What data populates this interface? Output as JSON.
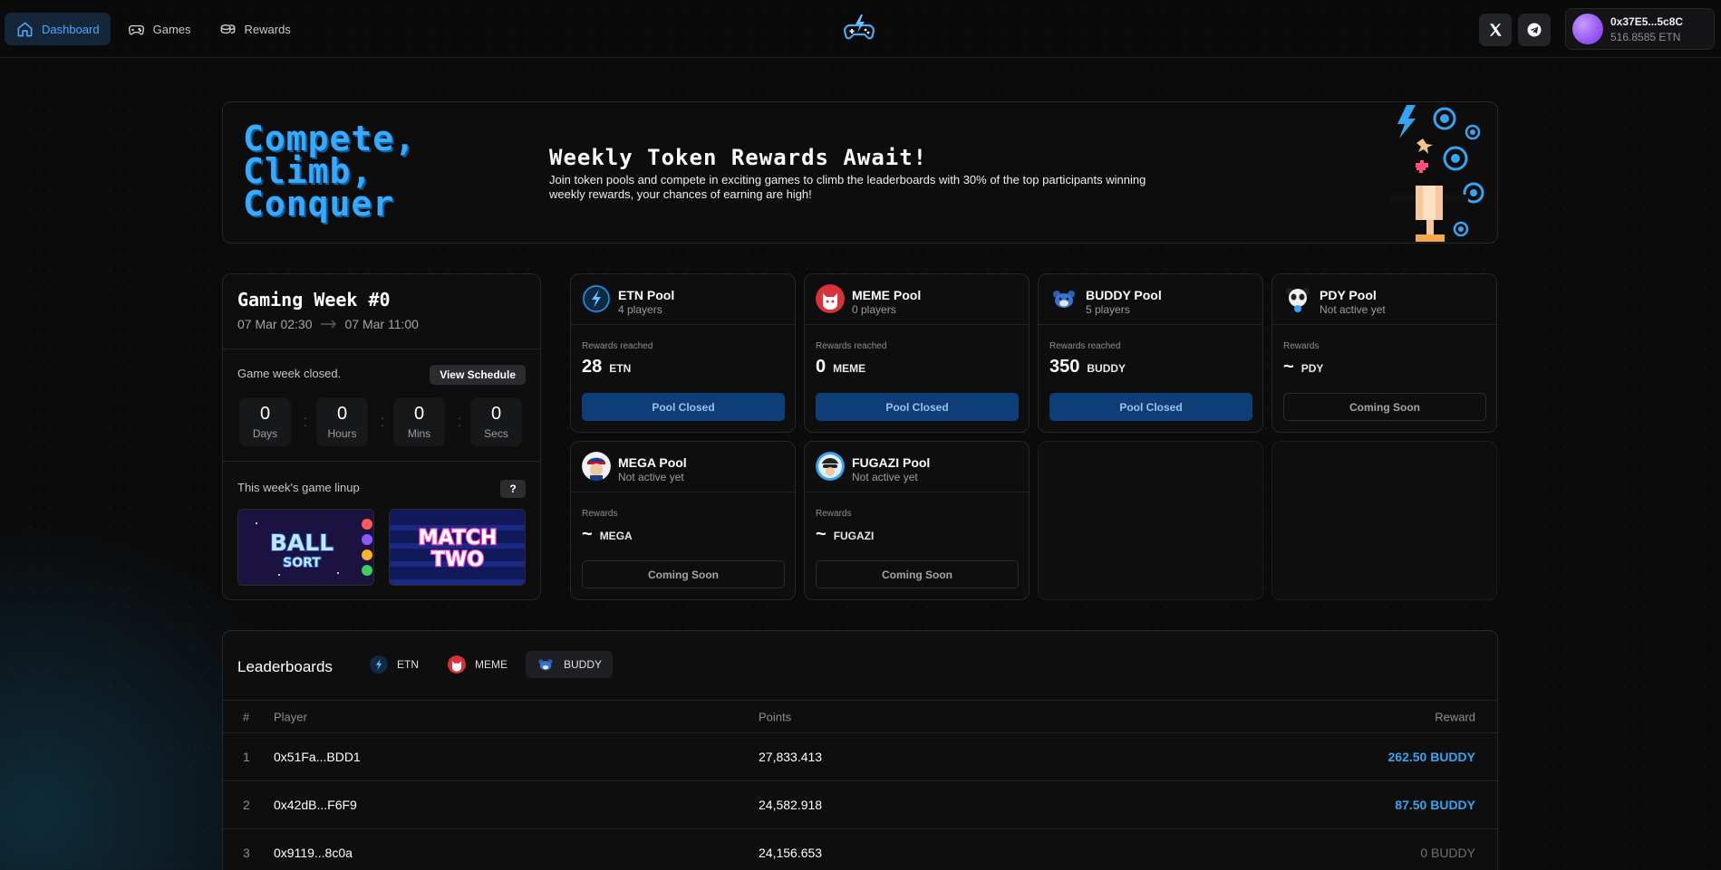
{
  "nav": {
    "items": [
      {
        "label": "Dashboard",
        "icon": "home-icon",
        "active": true
      },
      {
        "label": "Games",
        "icon": "gamepad-icon",
        "active": false
      },
      {
        "label": "Rewards",
        "icon": "coins-icon",
        "active": false
      }
    ],
    "logo": "gamepad-logo-icon"
  },
  "wallet": {
    "address": "0x37E5...5c8C",
    "balance": "516.8585 ETN"
  },
  "hero": {
    "title_lines": [
      "Compete,",
      "Climb,",
      "Conquer"
    ],
    "subtitle": "Weekly Token Rewards Await!",
    "description": "Join token pools and compete in exciting games to climb the leaderboards with 30% of the top participants winning weekly rewards, your chances of earning are high!"
  },
  "week": {
    "title": "Gaming Week #0",
    "start": "07 Mar 02:30",
    "end": "07 Mar 11:00",
    "status": "Game week closed.",
    "schedule_button": "View Schedule",
    "countdown": [
      {
        "value": "0",
        "label": "Days"
      },
      {
        "value": "0",
        "label": "Hours"
      },
      {
        "value": "0",
        "label": "Mins"
      },
      {
        "value": "0",
        "label": "Secs"
      }
    ],
    "lineup_label": "This week's game linup",
    "help_button": "?",
    "games": [
      {
        "line1": "BALL",
        "line2": "SORT"
      },
      {
        "line1": "MATCH",
        "line2": "TWO"
      }
    ]
  },
  "pools": [
    {
      "name": "ETN Pool",
      "sub": "4 players",
      "reward_label": "Rewards reached",
      "value": "28",
      "token": "ETN",
      "button": "Pool Closed",
      "state": "closed"
    },
    {
      "name": "MEME Pool",
      "sub": "0 players",
      "reward_label": "Rewards reached",
      "value": "0",
      "token": "MEME",
      "button": "Pool Closed",
      "state": "closed"
    },
    {
      "name": "BUDDY Pool",
      "sub": "5 players",
      "reward_label": "Rewards reached",
      "value": "350",
      "token": "BUDDY",
      "button": "Pool Closed",
      "state": "closed"
    },
    {
      "name": "PDY Pool",
      "sub": "Not active yet",
      "reward_label": "Rewards",
      "value": "~",
      "token": "PDY",
      "button": "Coming Soon",
      "state": "soon"
    },
    {
      "name": "MEGA Pool",
      "sub": "Not active yet",
      "reward_label": "Rewards",
      "value": "~",
      "token": "MEGA",
      "button": "Coming Soon",
      "state": "soon"
    },
    {
      "name": "FUGAZI Pool",
      "sub": "Not active yet",
      "reward_label": "Rewards",
      "value": "~",
      "token": "FUGAZI",
      "button": "Coming Soon",
      "state": "soon"
    }
  ],
  "leaderboard": {
    "title": "Leaderboards",
    "tabs": [
      {
        "label": "ETN",
        "active": false
      },
      {
        "label": "MEME",
        "active": false
      },
      {
        "label": "BUDDY",
        "active": true
      }
    ],
    "columns": {
      "rank": "#",
      "player": "Player",
      "points": "Points",
      "reward": "Reward"
    },
    "rows": [
      {
        "rank": "1",
        "player": "0x51Fa...BDD1",
        "points": "27,833.413",
        "reward": "262.50 BUDDY",
        "highlight": true
      },
      {
        "rank": "2",
        "player": "0x42dB...F6F9",
        "points": "24,582.918",
        "reward": "87.50 BUDDY",
        "highlight": true
      },
      {
        "rank": "3",
        "player": "0x9119...8c0a",
        "points": "24,156.653",
        "reward": "0 BUDDY",
        "highlight": false
      }
    ]
  },
  "colors": {
    "accent": "#38a9ff",
    "closed_button": "#0e3e78",
    "reward_positive": "#3aa3f0",
    "reward_zero": "#6e6f74"
  }
}
